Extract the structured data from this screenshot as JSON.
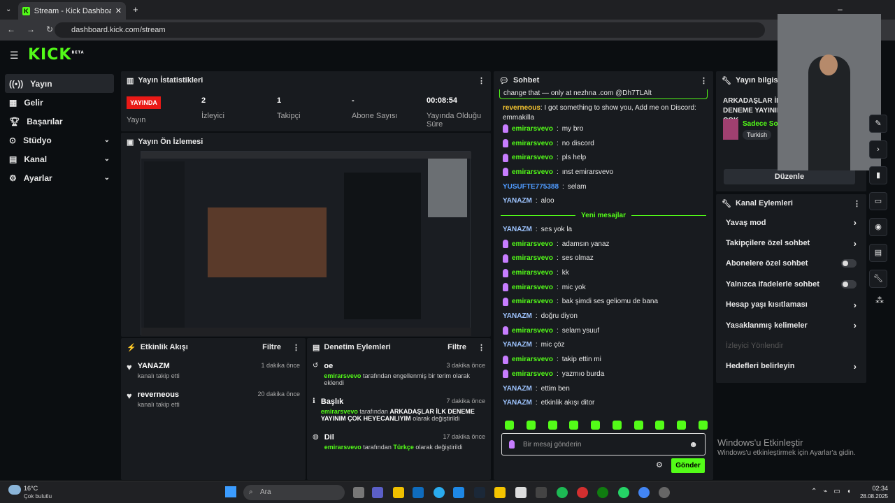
{
  "browser": {
    "tab_title": "Stream - Kick Dashboard",
    "url": "dashboard.kick.com/stream"
  },
  "brand": {
    "logo": "KICK",
    "beta": "BETA",
    "accent": "#53fc18"
  },
  "sidebar": {
    "items": [
      {
        "label": "Yayın",
        "icon": "broadcast-icon"
      },
      {
        "label": "Gelir",
        "icon": "revenue-icon"
      },
      {
        "label": "Başarılar",
        "icon": "trophy-icon"
      },
      {
        "label": "Stüdyo",
        "icon": "studio-icon"
      },
      {
        "label": "Kanal",
        "icon": "channel-icon"
      },
      {
        "label": "Ayarlar",
        "icon": "gear-icon"
      }
    ]
  },
  "stats": {
    "title": "Yayın İstatistikleri",
    "badge": "YAYINDA",
    "status_label": "Yayın",
    "viewers_value": "2",
    "viewers_label": "İzleyici",
    "followers_value": "1",
    "followers_label": "Takipçi",
    "subs_value": "-",
    "subs_label": "Abone Sayısı",
    "duration_value": "00:08:54",
    "duration_label": "Yayında Olduğu Süre"
  },
  "preview": {
    "title": "Yayın Ön İzlemesi"
  },
  "activity": {
    "title": "Etkinlik Akışı",
    "filter": "Filtre",
    "items": [
      {
        "name": "YANAZM",
        "sub": "kanalı takip etti",
        "time": "1 dakika önce"
      },
      {
        "name": "reverneous",
        "sub": "kanalı takip etti",
        "time": "20 dakika önce"
      }
    ]
  },
  "moderation": {
    "title": "Denetim Eylemleri",
    "filter": "Filtre",
    "items": [
      {
        "title": "oe",
        "time": "3 dakika önce",
        "user": "emirarsvevo",
        "text": "tarafından engellenmiş bir terim olarak eklendi",
        "icon": "undo-icon"
      },
      {
        "title": "Başlık",
        "time": "7 dakika önce",
        "user": "emirarsvevo",
        "text": "tarafından",
        "highlight": "ARKADAŞLAR İLK DENEME YAYINIM ÇOK HEYECANLIYIM",
        "tail": "olarak değiştirildi",
        "icon": "title-icon"
      },
      {
        "title": "Dil",
        "time": "17 dakika önce",
        "user": "emirarsvevo",
        "text": "tarafından",
        "highlight": "Türkçe",
        "tail": "olarak değiştirildi",
        "icon": "globe-icon"
      }
    ]
  },
  "chat": {
    "title": "Sohbet",
    "pinned": "change that — only at nezhna .com @Dh7TLAlt",
    "new_messages": "Yeni mesajlar",
    "messages": [
      {
        "user": "reverneous",
        "text": "I got something to show you, Add me on Discord: emmakilla",
        "color": "#f4c430",
        "mic": false
      },
      {
        "user": "emirarsvevo",
        "text": "my bro",
        "color": "#53fc18",
        "mic": true
      },
      {
        "user": "emirarsvevo",
        "text": "no discord",
        "color": "#53fc18",
        "mic": true
      },
      {
        "user": "emirarsvevo",
        "text": "pls help",
        "color": "#53fc18",
        "mic": true
      },
      {
        "user": "emirarsvevo",
        "text": "ınst emirarsvevo",
        "color": "#53fc18",
        "mic": true
      },
      {
        "user": "YUSUFTE775388",
        "text": "selam",
        "color": "#4f9bff",
        "mic": false
      },
      {
        "user": "YANAZM",
        "text": "aloo",
        "color": "#9ec4ff",
        "mic": false
      },
      {
        "user": "YANAZM",
        "text": "ses yok la",
        "color": "#9ec4ff",
        "mic": false
      },
      {
        "user": "emirarsvevo",
        "text": "adamsın yanaz",
        "color": "#53fc18",
        "mic": true
      },
      {
        "user": "emirarsvevo",
        "text": "ses olmaz",
        "color": "#53fc18",
        "mic": true
      },
      {
        "user": "emirarsvevo",
        "text": "kk",
        "color": "#53fc18",
        "mic": true
      },
      {
        "user": "emirarsvevo",
        "text": "mic yok",
        "color": "#53fc18",
        "mic": true
      },
      {
        "user": "emirarsvevo",
        "text": "bak şimdi ses geliomu de bana",
        "color": "#53fc18",
        "mic": true
      },
      {
        "user": "YANAZM",
        "text": "doğru diyon",
        "color": "#9ec4ff",
        "mic": false
      },
      {
        "user": "emirarsvevo",
        "text": "selam ysuuf",
        "color": "#53fc18",
        "mic": true
      },
      {
        "user": "YANAZM",
        "text": "mic çöz",
        "color": "#9ec4ff",
        "mic": false
      },
      {
        "user": "emirarsvevo",
        "text": "takip ettin mi",
        "color": "#53fc18",
        "mic": true
      },
      {
        "user": "emirarsvevo",
        "text": "yazmıo burda",
        "color": "#53fc18",
        "mic": true
      },
      {
        "user": "YANAZM",
        "text": "ettim ben",
        "color": "#9ec4ff",
        "mic": false
      },
      {
        "user": "YANAZM",
        "text": "etkinlik akışı ditor",
        "color": "#9ec4ff",
        "mic": false
      }
    ],
    "input_placeholder": "Bir mesaj gönderin",
    "send": "Gönder"
  },
  "stream_info": {
    "title": "Yayın bilgisi",
    "stream_title": "ARKADAŞLAR İLK DENEME YAYINIM ÇOK HEYECANLIYIM",
    "category": "Sadece Sohbet",
    "language": "Turkish",
    "edit": "Düzenle"
  },
  "channel_actions": {
    "title": "Kanal Eylemleri",
    "items": [
      {
        "label": "Yavaş mod",
        "type": "arrow"
      },
      {
        "label": "Takipçilere özel sohbet",
        "type": "arrow"
      },
      {
        "label": "Abonelere özel sohbet",
        "type": "toggle"
      },
      {
        "label": "Yalnızca ifadelerle sohbet",
        "type": "toggle"
      },
      {
        "label": "Hesap yaşı kısıtlaması",
        "type": "arrow"
      },
      {
        "label": "Yasaklanmış kelimeler",
        "type": "arrow"
      },
      {
        "label": "İzleyici Yönlendir",
        "type": "disabled"
      },
      {
        "label": "Hedefleri belirleyin",
        "type": "arrow"
      }
    ]
  },
  "windows": {
    "activate_title": "Windows'u Etkinleştir",
    "activate_sub": "Windows'u etkinleştirmek için Ayarlar'a gidin.",
    "weather_temp": "16°C",
    "weather_text": "Çok bulutlu",
    "search_placeholder": "Ara",
    "time": "02:34",
    "date": "28.08.2025"
  }
}
